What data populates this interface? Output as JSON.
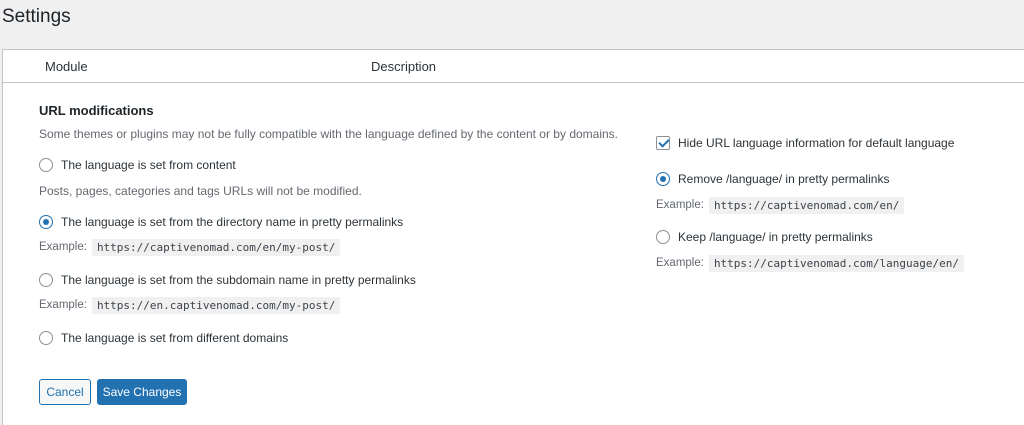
{
  "page": {
    "title": "Settings"
  },
  "table": {
    "col_module": "Module",
    "col_description": "Description"
  },
  "url_modifications": {
    "title": "URL modifications",
    "warning": "Some themes or plugins may not be fully compatible with the language defined by the content or by domains.",
    "example_label": "Example:",
    "options": [
      {
        "label": "The language is set from content",
        "checked": false,
        "note": "Posts, pages, categories and tags URLs will not be modified."
      },
      {
        "label": "The language is set from the directory name in pretty permalinks",
        "checked": true,
        "example": "https://captivenomad.com/en/my-post/"
      },
      {
        "label": "The language is set from the subdomain name in pretty permalinks",
        "checked": false,
        "example": "https://en.captivenomad.com/my-post/"
      },
      {
        "label": "The language is set from different domains",
        "checked": false
      }
    ],
    "hide_default": {
      "label": "Hide URL language information for default language",
      "checked": true
    },
    "permalink_options": [
      {
        "label": "Remove /language/ in pretty permalinks",
        "checked": true,
        "example": "https://captivenomad.com/en/"
      },
      {
        "label": "Keep /language/ in pretty permalinks",
        "checked": false,
        "example": "https://captivenomad.com/language/en/"
      }
    ]
  },
  "buttons": {
    "cancel": "Cancel",
    "save": "Save Changes"
  },
  "colors": {
    "accent": "#2271b1",
    "background": "#f0f0f1",
    "panel": "#ffffff"
  }
}
